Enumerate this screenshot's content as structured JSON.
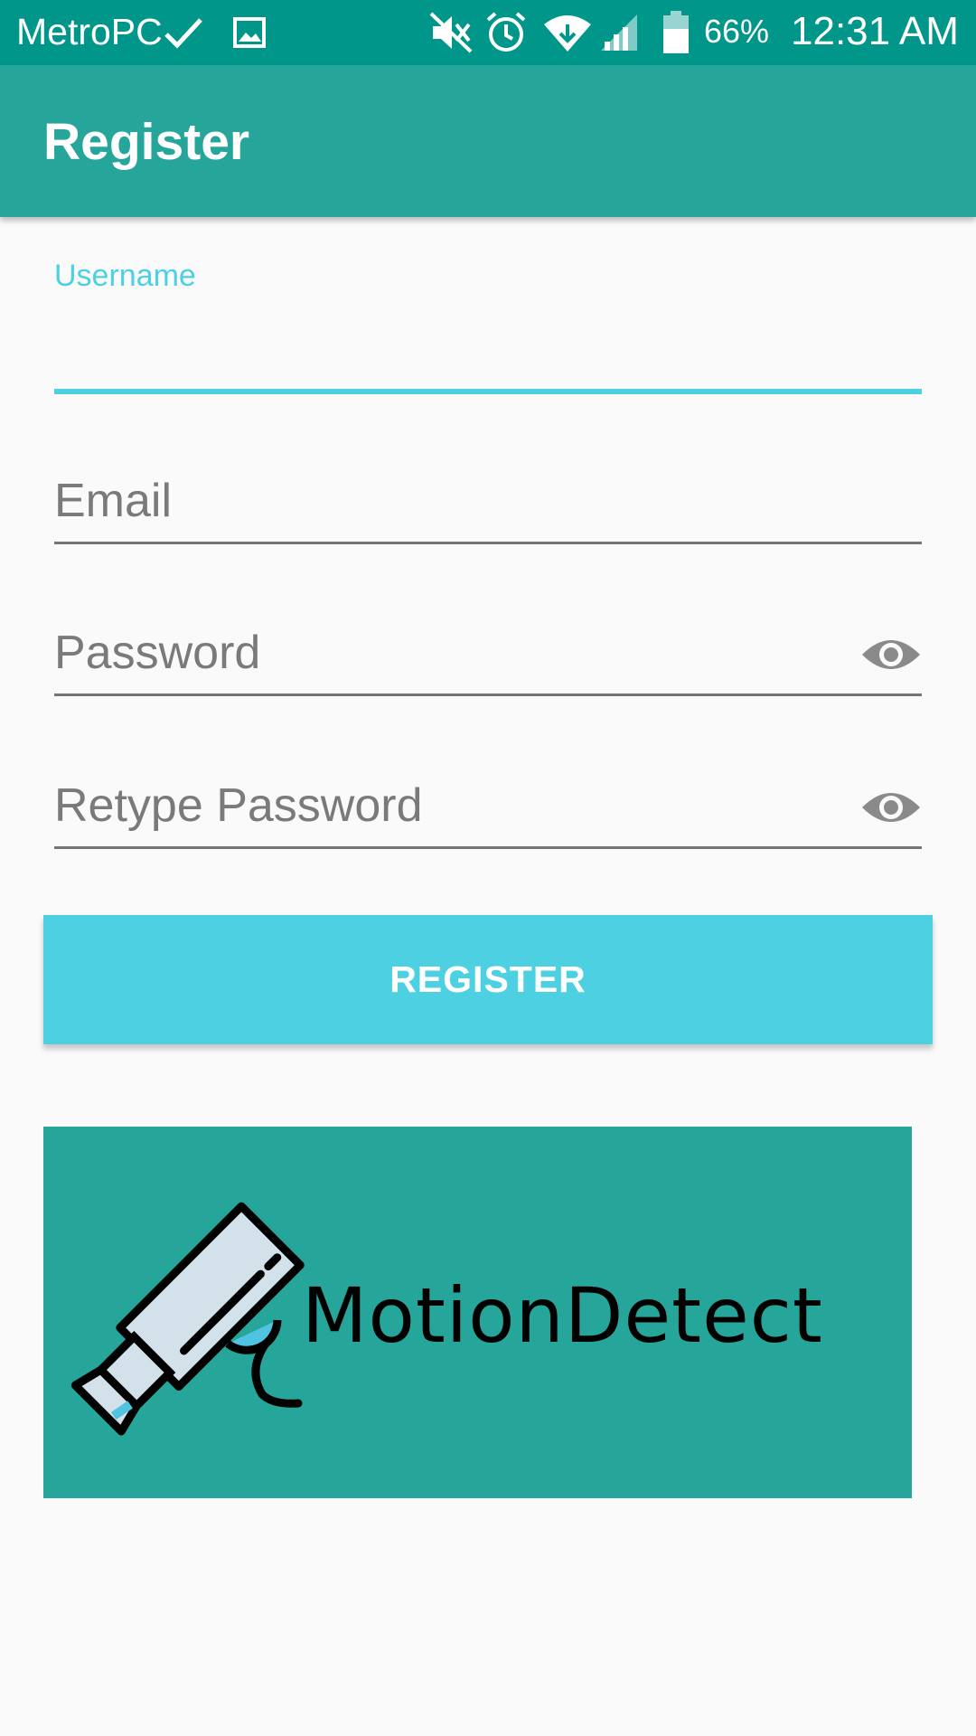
{
  "status_bar": {
    "carrier": "MetroPCS",
    "battery_percent": "66%",
    "time": "12:31 AM",
    "icons": [
      "check-icon",
      "image-icon",
      "mute-icon",
      "alarm-icon",
      "wifi-icon",
      "signal-icon",
      "battery-icon"
    ]
  },
  "app_bar": {
    "title": "Register"
  },
  "form": {
    "username": {
      "label": "Username",
      "value": ""
    },
    "email": {
      "placeholder": "Email",
      "value": ""
    },
    "password": {
      "placeholder": "Password",
      "value": ""
    },
    "retype_password": {
      "placeholder": "Retype Password",
      "value": ""
    },
    "register_label": "REGISTER"
  },
  "logo": {
    "text": "MotionDetect"
  },
  "colors": {
    "status_bar": "#00968a",
    "app_bar": "#26a69a",
    "accent": "#4dd0e1",
    "background": "#fafafa",
    "hint": "#7a7a7a"
  }
}
